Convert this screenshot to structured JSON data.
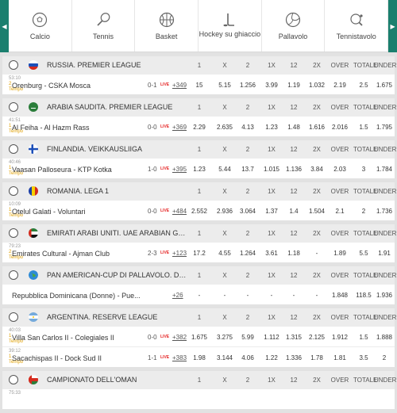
{
  "sports": [
    {
      "label": "Calcio",
      "icon": "soccer-ball-icon"
    },
    {
      "label": "Tennis",
      "icon": "tennis-racket-icon"
    },
    {
      "label": "Basket",
      "icon": "basketball-icon"
    },
    {
      "label": "Hockey su ghiaccio",
      "icon": "hockey-stick-icon"
    },
    {
      "label": "Pallavolo",
      "icon": "volleyball-icon"
    },
    {
      "label": "Tennistavolo",
      "icon": "ping-pong-paddle-icon"
    }
  ],
  "columns": [
    "1",
    "X",
    "2",
    "1X",
    "12",
    "2X",
    "OVER",
    "TOTALE",
    "UNDER"
  ],
  "live_label": "LIVE",
  "leagues": [
    {
      "name": "RUSSIA. PREMIER LEAGUE",
      "flag": "russia",
      "matches": [
        {
          "time": "53:10",
          "period": "2",
          "phase": "Tempo",
          "teams": "Orenburg - CSKA Mosca",
          "score": "0-1",
          "more": "+349",
          "odds": [
            "15",
            "5.15",
            "1.256",
            "3.99",
            "1.19",
            "1.032",
            "2.19",
            "2.5",
            "1.675"
          ]
        }
      ]
    },
    {
      "name": "ARABIA SAUDITA. PREMIER LEAGUE",
      "flag": "saudi",
      "matches": [
        {
          "time": "41:51",
          "period": "1",
          "phase": "Tempo",
          "teams": "Al Feiha - Al Hazm Rass",
          "score": "0-0",
          "more": "+369",
          "odds": [
            "2.29",
            "2.635",
            "4.13",
            "1.23",
            "1.48",
            "1.616",
            "2.016",
            "1.5",
            "1.795"
          ]
        }
      ]
    },
    {
      "name": "FINLANDIA. VEIKKAUSLIIGA",
      "flag": "finland",
      "matches": [
        {
          "time": "40:46",
          "period": "1",
          "phase": "Tempo",
          "teams": "Vaasan Palloseura - KTP Kotka",
          "score": "1-0",
          "more": "+395",
          "odds": [
            "1.23",
            "5.44",
            "13.7",
            "1.015",
            "1.136",
            "3.84",
            "2.03",
            "3",
            "1.784"
          ]
        }
      ]
    },
    {
      "name": "ROMANIA. LEGA 1",
      "flag": "romania",
      "matches": [
        {
          "time": "10:09",
          "period": "1",
          "phase": "Tempo",
          "teams": "Otelul Galati - Voluntari",
          "score": "0-0",
          "more": "+484",
          "odds": [
            "2.552",
            "2.936",
            "3.064",
            "1.37",
            "1.4",
            "1.504",
            "2.1",
            "2",
            "1.736"
          ]
        }
      ]
    },
    {
      "name": "EMIRATI ARABI UNITI. UAE ARABIAN GUL...",
      "flag": "uae",
      "matches": [
        {
          "time": "79:23",
          "period": "2",
          "phase": "Tempo",
          "teams": "Emirates Cultural - Ajman Club",
          "score": "2-3",
          "more": "+123",
          "odds": [
            "17.2",
            "4.55",
            "1.264",
            "3.61",
            "1.18",
            "-",
            "1.89",
            "5.5",
            "1.91"
          ]
        }
      ]
    },
    {
      "name": "PAN AMERICAN-CUP DI PALLAVOLO. DO...",
      "flag": "globe",
      "sport": "volleyball",
      "matches": [
        {
          "time": "",
          "period": "",
          "phase": "",
          "teams": "Repubblica Dominicana (Donne) - Pue...",
          "score": "",
          "more": "+26",
          "odds": [
            "-",
            "-",
            "-",
            "-",
            "-",
            "-",
            "1.848",
            "118.5",
            "1.936"
          ]
        }
      ]
    },
    {
      "name": "ARGENTINA. RESERVE LEAGUE",
      "flag": "argentina",
      "matches": [
        {
          "time": "40:03",
          "period": "1",
          "phase": "Tempo",
          "teams": "Villa San Carlos II - Colegiales II",
          "score": "0-0",
          "more": "+382",
          "odds": [
            "1.675",
            "3.275",
            "5.99",
            "1.112",
            "1.315",
            "2.125",
            "1.912",
            "1.5",
            "1.888"
          ]
        },
        {
          "time": "39:12",
          "period": "1",
          "phase": "Tempo",
          "teams": "Sacachispas II - Dock Sud II",
          "score": "1-1",
          "more": "+383",
          "odds": [
            "1.98",
            "3.144",
            "4.06",
            "1.22",
            "1.336",
            "1.78",
            "1.81",
            "3.5",
            "2"
          ]
        }
      ]
    },
    {
      "name": "CAMPIONATO DELL'OMAN",
      "flag": "oman",
      "matches": [
        {
          "time": "75:33",
          "period": "",
          "phase": "",
          "teams": "",
          "score": "",
          "more": "",
          "odds": []
        }
      ]
    }
  ]
}
